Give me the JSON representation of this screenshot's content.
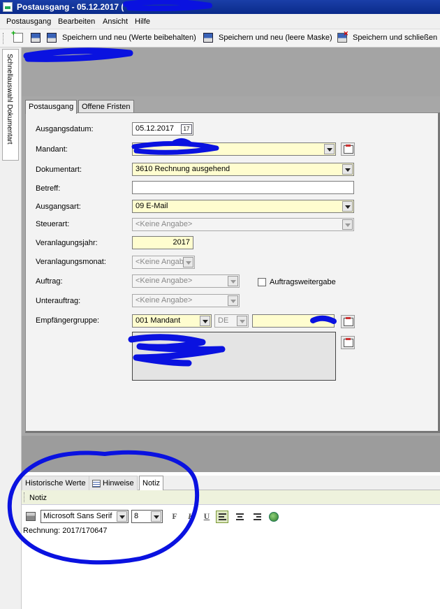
{
  "window": {
    "title": "Postausgang - 05.12.2017 ("
  },
  "menu": [
    "Postausgang",
    "Bearbeiten",
    "Ansicht",
    "Hilfe"
  ],
  "toolbar": {
    "save_new_keep": "Speichern und neu (Werte beibehalten)",
    "save_new_empty": "Speichern und neu (leere Maske)",
    "save_close": "Speichern und schließen"
  },
  "sidebar": {
    "tab_label": "Schnellauswahl Dokumentart"
  },
  "tabs": [
    "Postausgang",
    "Offene Fristen"
  ],
  "form": {
    "ausgangsdatum": {
      "label": "Ausgangsdatum:",
      "value": "05.12.2017",
      "cal_icon_text": "17"
    },
    "mandant": {
      "label": "Mandant:"
    },
    "dokumentart": {
      "label": "Dokumentart:",
      "value": "3610   Rechnung ausgehend"
    },
    "betreff": {
      "label": "Betreff:",
      "value": ""
    },
    "ausgangsart": {
      "label": "Ausgangsart:",
      "value": "09   E-Mail"
    },
    "steuerart": {
      "label": "Steuerart:",
      "value": "<Keine Angabe>"
    },
    "veranlagungsjahr": {
      "label": "Veranlagungsjahr:",
      "value": "2017"
    },
    "veranlagungsmonat": {
      "label": "Veranlagungsmonat:",
      "value": "<Keine Angab"
    },
    "auftrag": {
      "label": "Auftrag:",
      "value": "<Keine Angabe>",
      "checkbox_label": "Auftragsweitergabe",
      "checkbox_checked": false
    },
    "unterauftrag": {
      "label": "Unterauftrag:",
      "value": "<Keine Angabe>"
    },
    "empfaengergruppe": {
      "label": "Empfängergruppe:",
      "value": "001   Mandant",
      "country": "DE"
    }
  },
  "bottom_tabs": [
    "Historische Werte",
    "Hinweise",
    "Notiz"
  ],
  "note": {
    "bar_label": "Notiz",
    "font": "Microsoft Sans Serif",
    "size": "8",
    "format_buttons": [
      "F",
      "K",
      "U"
    ],
    "text": "Rechnung: 2017/170647"
  },
  "colors": {
    "titlebar": "#0a2a8a",
    "field_yellow": "#fffdcf",
    "annotation_blue": "#0a12e0"
  }
}
